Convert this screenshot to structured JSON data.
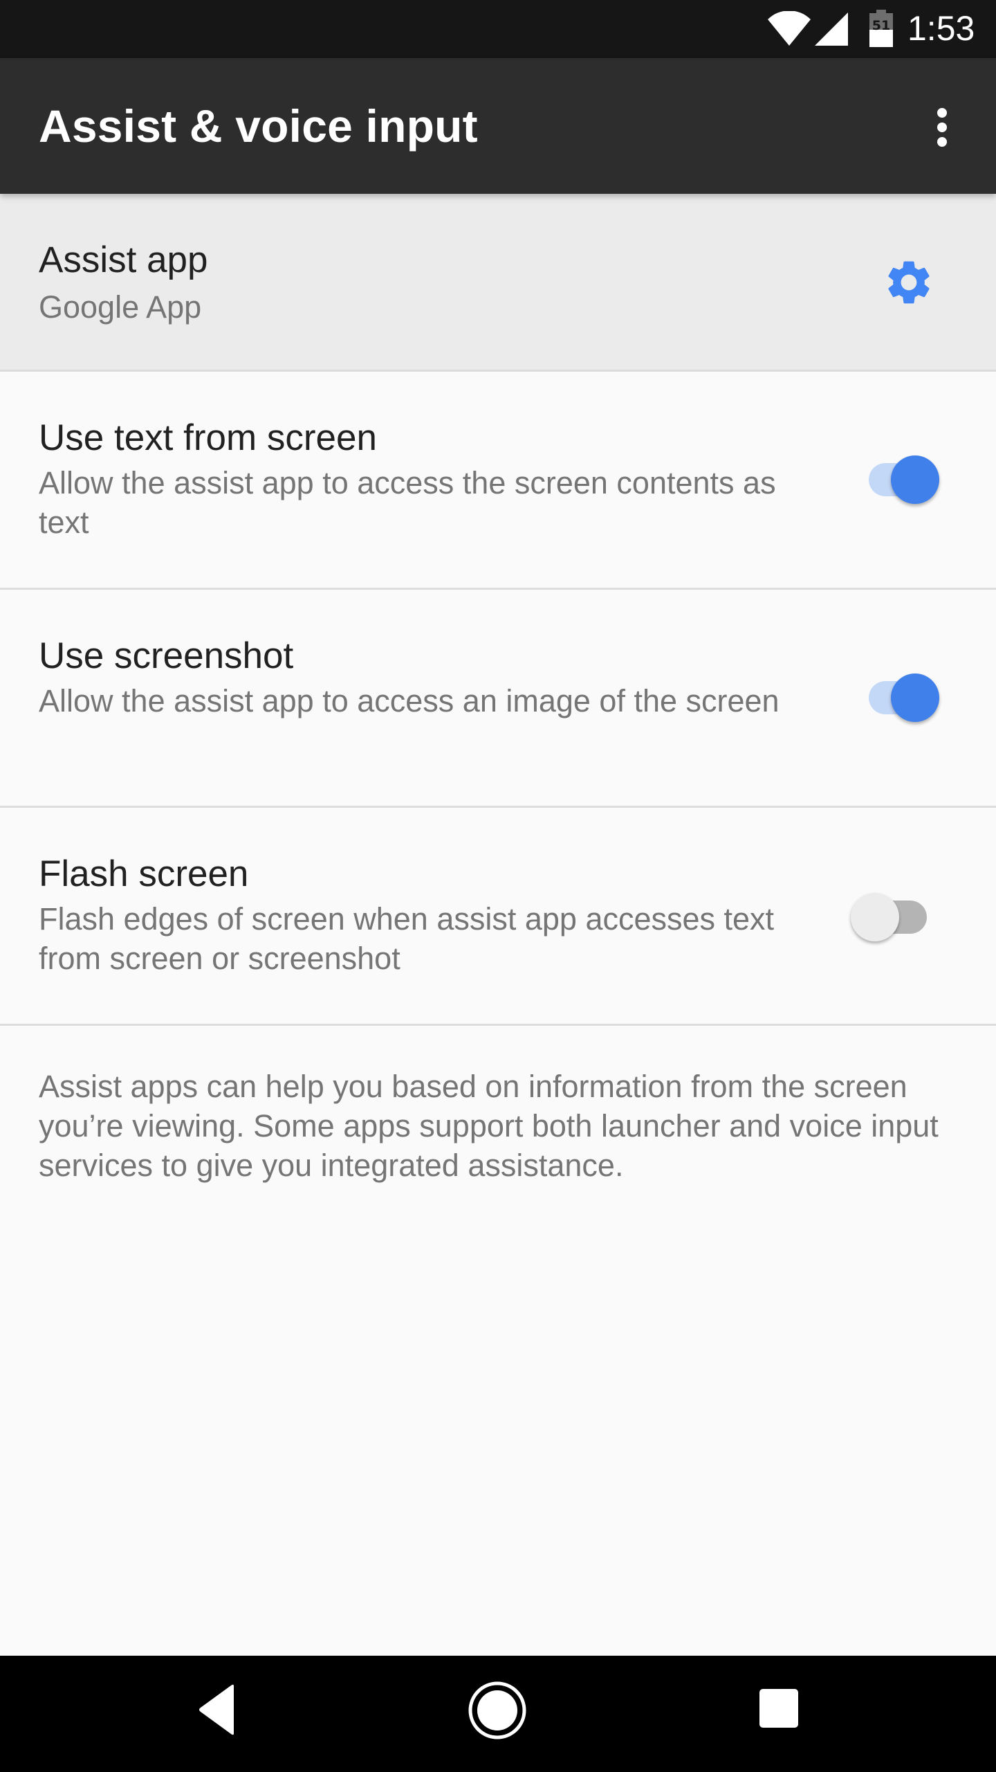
{
  "status_bar": {
    "time": "1:53",
    "battery_level": "51",
    "icons": [
      "wifi-icon",
      "cell-signal-icon",
      "battery-icon"
    ]
  },
  "app_bar": {
    "title": "Assist & voice input",
    "overflow_icon": "more-vert-icon"
  },
  "preferences": [
    {
      "title": "Assist app",
      "summary": "Google App",
      "action_icon": "gear-icon"
    },
    {
      "title": "Use text from screen",
      "summary": "Allow the assist app to access the screen contents as text",
      "checked": true
    },
    {
      "title": "Use screenshot",
      "summary": "Allow the assist app to access an image of the screen",
      "checked": true
    },
    {
      "title": "Flash screen",
      "summary": "Flash edges of screen when assist app accesses text from screen or screenshot",
      "checked": false
    }
  ],
  "footer": {
    "text": "Assist apps can help you based on information from the screen you’re viewing. Some apps support both launcher and voice input services to give you integrated assistance."
  },
  "nav_bar": {
    "buttons": [
      "back-icon",
      "home-icon",
      "recents-icon"
    ]
  },
  "colors": {
    "accent": "#4285f4",
    "status_bar": "#161616",
    "app_bar": "#2d2d2d",
    "nav_bar": "#000000"
  }
}
